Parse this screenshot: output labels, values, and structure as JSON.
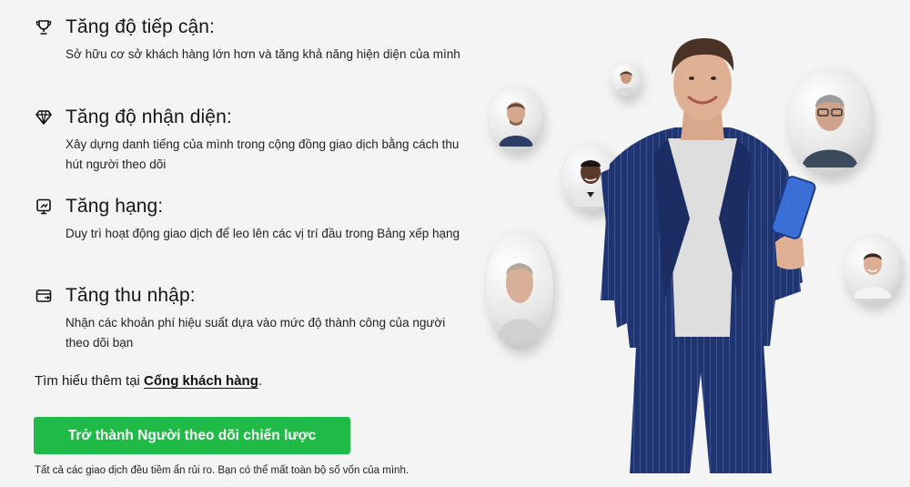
{
  "benefits": [
    {
      "icon": "trophy-icon",
      "title": "Tăng độ tiếp cận:",
      "desc": "Sở hữu cơ sở khách hàng lớn hơn và tăng khả năng hiện diện của mình"
    },
    {
      "icon": "diamond-icon",
      "title": "Tăng độ nhận diện:",
      "desc": "Xây dựng danh tiếng của mình trong cộng đồng giao dịch bằng cách thu hút người theo dõi"
    },
    {
      "icon": "ranking-icon",
      "title": "Tăng hạng:",
      "desc": "Duy trì hoạt động giao dịch để leo lên các vị trí đầu trong Bảng xếp hạng"
    },
    {
      "icon": "wallet-icon",
      "title": "Tăng thu nhập:",
      "desc": "Nhận các khoản phí hiệu suất dựa vào mức độ thành công của người theo dõi bạn"
    }
  ],
  "learn_more": {
    "prefix": "Tìm hiểu thêm tại ",
    "link": "Cổng khách hàng",
    "suffix": "."
  },
  "cta_label": "Trở thành Người theo dõi chiến lược",
  "disclaimer": "Tất cả các giao dịch đều tiềm ẩn rủi ro. Bạn có thể mất toàn bộ số vốn của mình.",
  "colors": {
    "accent": "#1fbb46",
    "suit": "#1f3470",
    "background": "#f4f4f4"
  }
}
